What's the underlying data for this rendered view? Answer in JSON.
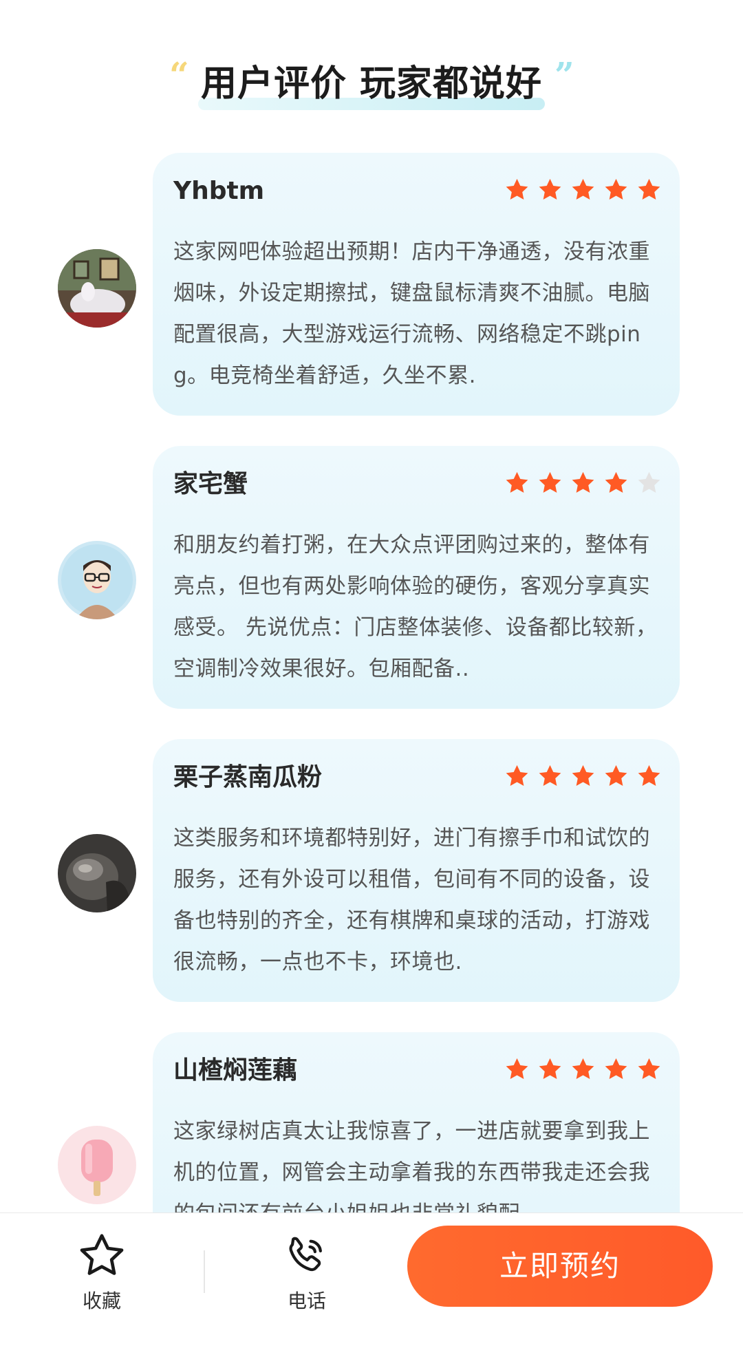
{
  "header": {
    "title": "用户评价 玩家都说好",
    "quote_left": "“",
    "quote_right": "”"
  },
  "reviews": [
    {
      "name": "Yhbtm",
      "rating": 5,
      "text": "这家网吧体验超出预期！店内干净通透，没有浓重烟味，外设定期擦拭，键盘鼠标清爽不油腻。电脑配置很高，大型游戏运行流畅、网络稳定不跳ping。电竞椅坐着舒适，久坐不累."
    },
    {
      "name": "家宅蟹",
      "rating": 4,
      "text": "和朋友约着打粥，在大众点评团购过来的，整体有亮点，但也有两处影响体验的硬伤，客观分享真实感受。 先说优点：门店整体装修、设备都比较新，空调制冷效果很好。包厢配备.."
    },
    {
      "name": "栗子蒸南瓜粉",
      "rating": 5,
      "text": "这类服务和环境都特别好，进门有擦手巾和试饮的服务，还有外设可以租借，包间有不同的设备，设备也特别的齐全，还有棋牌和桌球的活动，打游戏很流畅，一点也不卡，环境也."
    },
    {
      "name": "山楂焖莲藕",
      "rating": 5,
      "text": "这家绿树店真太让我惊喜了，一进店就要拿到我上机的位置，网管会主动拿着我的东西带我走还会我的包间还有前台小姐姐也非常礼貌配"
    }
  ],
  "bottom_bar": {
    "favorite_label": "收藏",
    "phone_label": "电话",
    "book_label": "立即预约"
  },
  "colors": {
    "star_active": "#ff5a24",
    "star_inactive": "#e3e3e3",
    "accent": "#ff6a2e",
    "card_bg": "#e8f7fc"
  }
}
